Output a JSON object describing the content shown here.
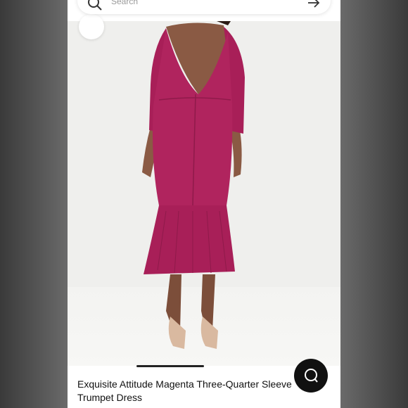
{
  "search": {
    "placeholder": "Search"
  },
  "product": {
    "title": "Exquisite Attitude Magenta Three-Quarter Sleeve Trumpet Dress",
    "dress_color": "#b0245e"
  },
  "icons": {
    "search": "search-icon",
    "arrow": "arrow-right-icon",
    "chat": "chat-icon"
  }
}
